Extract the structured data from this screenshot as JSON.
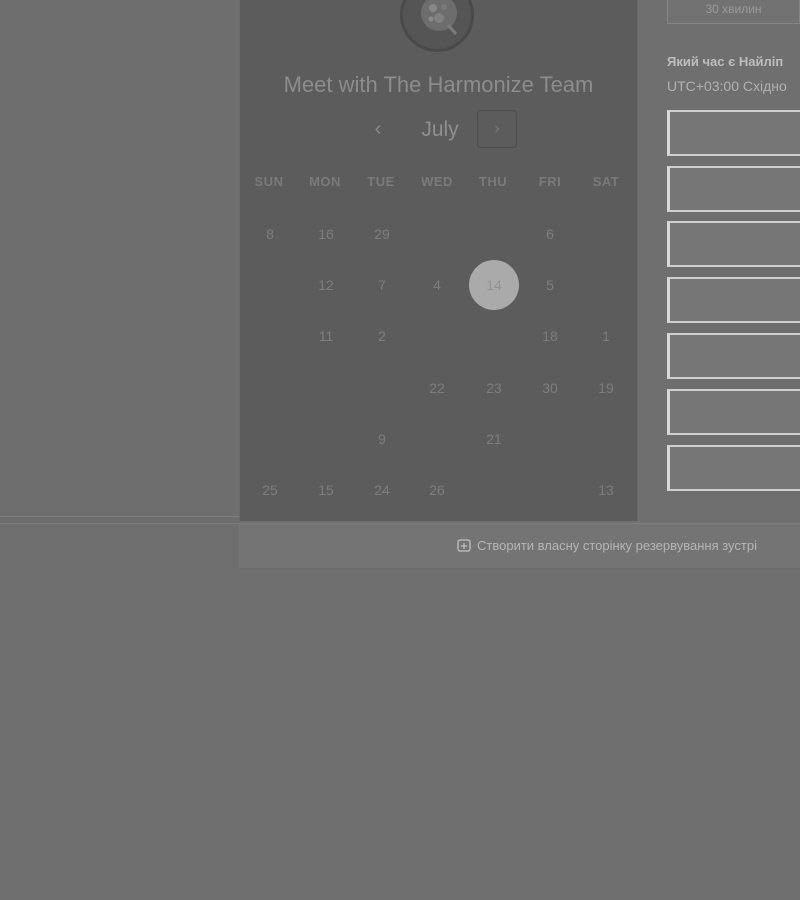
{
  "card": {
    "title": "Meet with The Harmonize Team",
    "month": "July",
    "prev_icon": "‹",
    "next_icon": "›",
    "weekdays": [
      "SUN",
      "MON",
      "TUE",
      "WED",
      "THU",
      "FRI",
      "SAT"
    ],
    "selected_day": "14",
    "rows": [
      [
        "8",
        "16",
        "29",
        "",
        "",
        "6",
        ""
      ],
      [
        "",
        "12",
        "7",
        "4",
        "14",
        "5",
        ""
      ],
      [
        "",
        "11",
        "2",
        "",
        "",
        "18",
        "1"
      ],
      [
        "",
        "",
        "",
        "22",
        "23",
        "30",
        "19"
      ],
      [
        "",
        "",
        "9",
        "",
        "21",
        "",
        ""
      ],
      [
        "25",
        "15",
        "24",
        "26",
        "",
        "",
        "13"
      ]
    ]
  },
  "right_panel": {
    "duration_label": "30 хвилин",
    "timezone_question": "Який час є Найліп",
    "timezone_value": "UTC+03:00 Східно",
    "slots": [
      "",
      "",
      "",
      "",
      "",
      "",
      ""
    ]
  },
  "footer": {
    "create_link": "Створити власну сторінку резервування зустрі"
  },
  "colors": {
    "card_bg": "#5c5c5c",
    "selected_day_bg": "#aaaaaa",
    "page_bg": "#6f6f6f"
  }
}
